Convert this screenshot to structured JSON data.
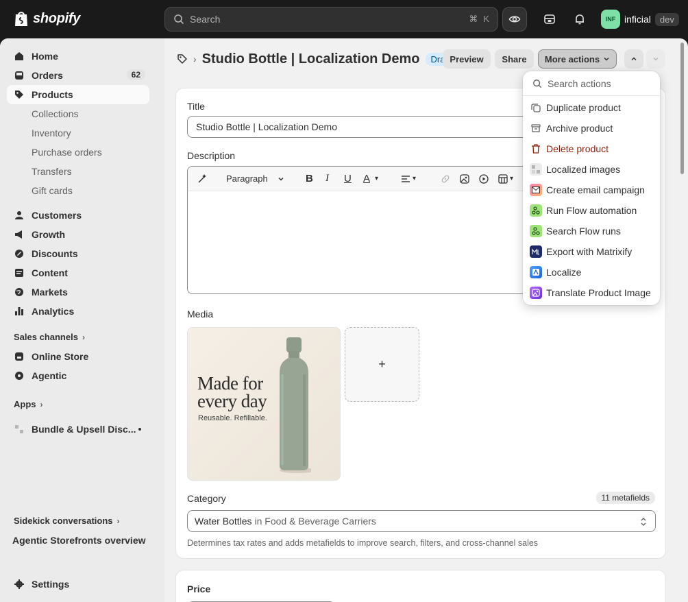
{
  "topbar": {
    "brand": "shopify",
    "search_placeholder": "Search",
    "shortcut_cmd": "⌘",
    "shortcut_key": "K",
    "account_initials": "INF",
    "account_name": "inficial",
    "account_tag": "dev"
  },
  "sidebar": {
    "home": "Home",
    "orders": "Orders",
    "orders_count": "62",
    "products": "Products",
    "products_sub": [
      "Collections",
      "Inventory",
      "Purchase orders",
      "Transfers",
      "Gift cards"
    ],
    "customers": "Customers",
    "growth": "Growth",
    "discounts": "Discounts",
    "content": "Content",
    "markets": "Markets",
    "analytics": "Analytics",
    "sales_channels": "Sales channels",
    "online_store": "Online Store",
    "agentic": "Agentic",
    "apps": "Apps",
    "app_bundle": "Bundle & Upsell Disc...",
    "sidekick": "Sidekick conversations",
    "sidekick_item": "Agentic Storefronts overview",
    "settings": "Settings"
  },
  "header": {
    "title": "Studio Bottle | Localization Demo",
    "status": "Draft",
    "preview": "Preview",
    "share": "Share",
    "more_actions": "More actions"
  },
  "product": {
    "title_label": "Title",
    "title_value": "Studio Bottle | Localization Demo",
    "description_label": "Description",
    "paragraph": "Paragraph",
    "media_label": "Media",
    "image_headline_1": "Made for",
    "image_headline_2": "every day",
    "image_sub": "Reusable. Refillable.",
    "add_media": "+",
    "category_label": "Category",
    "metafields": "11 metafields",
    "category_value": "Water Bottles",
    "category_in": "in Food & Beverage Carriers",
    "category_help": "Determines tax rates and adds metafields to improve search, filters, and cross-channel sales",
    "price_label": "Price"
  },
  "actions_menu": {
    "search_placeholder": "Search actions",
    "items": [
      "Duplicate product",
      "Archive product",
      "Delete product",
      "Localized images",
      "Create email campaign",
      "Run Flow automation",
      "Search Flow runs",
      "Export with Matrixify",
      "Localize",
      "Translate Product Image"
    ]
  },
  "colors": {
    "topbar": "#1a1a1a",
    "danger": "#8e1f0b",
    "draft_badge": "#d5ebff",
    "avatar": "#7ee0a7"
  }
}
